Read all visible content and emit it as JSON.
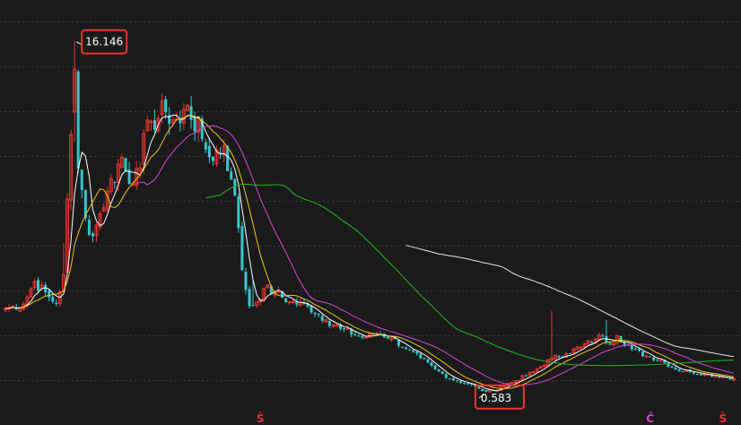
{
  "colors": {
    "background": "#1a1a1a",
    "grid": "#3a3a3a",
    "up": "#e8342e",
    "down": "#35c7cc",
    "highlight_box": "#e8342e",
    "ma5": "#ffffff",
    "ma10": "#f0c419",
    "ma20": "#d946d9",
    "ma60": "#22b922",
    "ma120": "#e6e6e6",
    "marker_s": "#e8342e",
    "marker_c": "#e040e0"
  },
  "chart_data": {
    "type": "candlestick",
    "title": "",
    "xlabel": "",
    "ylabel": "",
    "ylim": [
      -0.3,
      17.8
    ],
    "grid": "horizontal dotted",
    "annotations": {
      "high": {
        "value": 16.146,
        "label": "16.146"
      },
      "low": {
        "value": 0.583,
        "label": "0.583"
      }
    },
    "bottom_markers": [
      {
        "label": "Ŝ",
        "bar_index": 70,
        "color_key": "marker_s"
      },
      {
        "label": "Ĉ",
        "bar_index": 177,
        "color_key": "marker_c"
      },
      {
        "label": "Ŝ",
        "bar_index": 197,
        "color_key": "marker_s"
      }
    ],
    "moving_averages": [
      {
        "key": "ma5",
        "period": 5
      },
      {
        "key": "ma10",
        "period": 10
      },
      {
        "key": "ma20",
        "period": 20,
        "start": 36
      },
      {
        "key": "ma60",
        "period": 60,
        "start": 55
      },
      {
        "key": "ma120",
        "period": 120,
        "start": 110
      }
    ],
    "close_anchors": [
      [
        0,
        4.3
      ],
      [
        5,
        4.5
      ],
      [
        8,
        5.5
      ],
      [
        12,
        4.8
      ],
      [
        14,
        4.5
      ],
      [
        16,
        5.8
      ],
      [
        18,
        12.0
      ],
      [
        19,
        14.9
      ],
      [
        20,
        10.5
      ],
      [
        22,
        8.3
      ],
      [
        24,
        7.5
      ],
      [
        26,
        8.5
      ],
      [
        28,
        9.5
      ],
      [
        32,
        11.0
      ],
      [
        34,
        9.8
      ],
      [
        36,
        10.5
      ],
      [
        40,
        12.6
      ],
      [
        44,
        13.0
      ],
      [
        48,
        12.5
      ],
      [
        50,
        13.3
      ],
      [
        54,
        11.8
      ],
      [
        56,
        11.0
      ],
      [
        60,
        11.5
      ],
      [
        62,
        10.0
      ],
      [
        63,
        9.3
      ],
      [
        65,
        6.0
      ],
      [
        67,
        4.4
      ],
      [
        69,
        4.6
      ],
      [
        71,
        5.2
      ],
      [
        74,
        5.0
      ],
      [
        78,
        4.6
      ],
      [
        83,
        4.4
      ],
      [
        88,
        3.8
      ],
      [
        92,
        3.4
      ],
      [
        98,
        3.0
      ],
      [
        102,
        3.2
      ],
      [
        106,
        3.0
      ],
      [
        110,
        2.5
      ],
      [
        114,
        2.1
      ],
      [
        118,
        1.6
      ],
      [
        122,
        1.2
      ],
      [
        127,
        0.95
      ],
      [
        130,
        0.75
      ],
      [
        132,
        0.62
      ],
      [
        134,
        0.66
      ],
      [
        136,
        0.85
      ],
      [
        140,
        1.1
      ],
      [
        145,
        1.5
      ],
      [
        150,
        2.1
      ],
      [
        154,
        2.3
      ],
      [
        158,
        2.6
      ],
      [
        162,
        2.95
      ],
      [
        164,
        3.1
      ],
      [
        166,
        2.7
      ],
      [
        168,
        3.1
      ],
      [
        172,
        2.5
      ],
      [
        176,
        2.2
      ],
      [
        180,
        2.0
      ],
      [
        184,
        1.6
      ],
      [
        188,
        1.5
      ],
      [
        192,
        1.4
      ],
      [
        200,
        1.2
      ]
    ]
  }
}
